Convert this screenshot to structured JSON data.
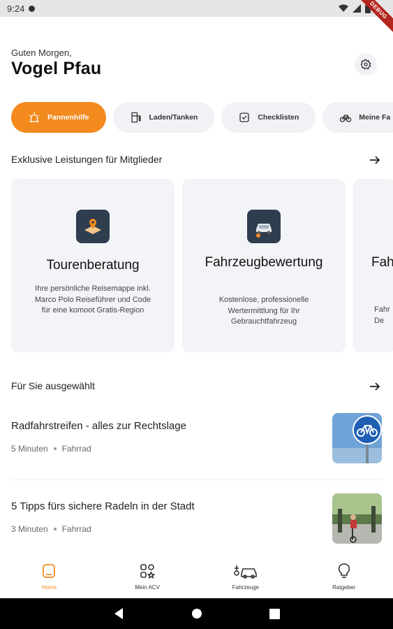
{
  "status_bar": {
    "time": "9:24",
    "debug_label": "DEBUG"
  },
  "header": {
    "greeting": "Guten Morgen,",
    "username": "Vogel Pfau"
  },
  "chips": [
    {
      "label": "Pannenhilfe",
      "icon": "siren-icon",
      "active": true
    },
    {
      "label": "Laden/Tanken",
      "icon": "fuel-pump-icon",
      "active": false
    },
    {
      "label": "Checklisten",
      "icon": "checklist-icon",
      "active": false
    },
    {
      "label": "Meine Fa",
      "icon": "bicycle-icon",
      "active": false
    }
  ],
  "exclusive": {
    "title": "Exklusive Leistungen für Mitglieder",
    "cards": [
      {
        "title": "Tourenberatung",
        "description": "Ihre persönliche Reisemappe inkl. Marco Polo Reiseführer und Code für eine komoot Gratis-Region",
        "icon": "map-pin-icon"
      },
      {
        "title": "Fahrzeugbewertung",
        "description": "Kostenlose, professionelle Wertermittlung für Ihr Gebrauchtfahrzeug",
        "icon": "car-valuation-icon"
      },
      {
        "title": "Fah",
        "description": "Fahr De",
        "icon": ""
      }
    ]
  },
  "selected": {
    "title": "Für Sie ausgewählt",
    "articles": [
      {
        "title": "Radfahrstreifen - alles zur Rechtslage",
        "duration": "5 Minuten",
        "category": "Fahrrad"
      },
      {
        "title": "5 Tipps fürs sichere Radeln in der Stadt",
        "duration": "3 Minuten",
        "category": "Fahrrad"
      }
    ]
  },
  "bottom_nav": [
    {
      "label": "Home",
      "icon": "home-icon",
      "active": true
    },
    {
      "label": "Mein ACV",
      "icon": "grid-icon",
      "active": false
    },
    {
      "label": "Fahrzeuge",
      "icon": "vehicles-icon",
      "active": false
    },
    {
      "label": "Ratgeber",
      "icon": "lightbulb-icon",
      "active": false
    }
  ],
  "colors": {
    "accent": "#f28a1e",
    "card_bg": "#f3f4f7",
    "icon_box": "#2f3e4f"
  }
}
